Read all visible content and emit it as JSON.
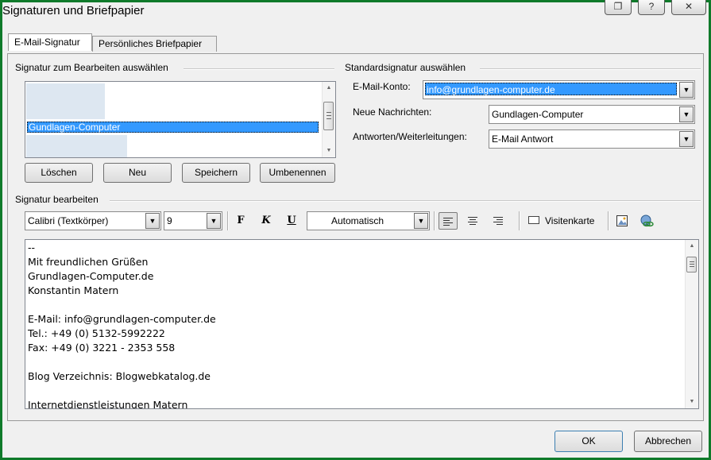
{
  "window": {
    "title": "Signaturen und Briefpapier",
    "title_buttons": [
      "❐",
      "?",
      "✕"
    ]
  },
  "tabs": [
    {
      "label": "E-Mail-Signatur",
      "active": true
    },
    {
      "label": "Persönliches Briefpapier",
      "active": false
    }
  ],
  "signature_select": {
    "group_label": "Signatur zum Bearbeiten auswählen",
    "items": [
      "",
      "Gundlagen-Computer",
      ""
    ],
    "selected_index": 1,
    "buttons": {
      "delete": "Löschen",
      "new": "Neu",
      "save": "Speichern",
      "rename": "Umbenennen"
    }
  },
  "default_signature": {
    "group_label": "Standardsignatur auswählen",
    "account_label": "E-Mail-Konto:",
    "account_value": "info@grundlagen-computer.de",
    "new_messages_label": "Neue Nachrichten:",
    "new_messages_value": "Gundlagen-Computer",
    "replies_label": "Antworten/Weiterleitungen:",
    "replies_value": "E-Mail Antwort"
  },
  "editor": {
    "group_label": "Signatur bearbeiten",
    "font": "Calibri (Textkörper)",
    "size": "9",
    "bold": "F",
    "italic": "K",
    "underline": "U",
    "color": "Automatisch",
    "business_card": "Visitenkarte",
    "lines": [
      "--",
      "Mit freundlichen Grüßen",
      "Grundlagen-Computer.de",
      "Konstantin Matern",
      "",
      "E-Mail: info@grundlagen-computer.de",
      "Tel.: +49 (0) 5132-5992222",
      "Fax: +49 (0) 3221 - 2353 558",
      "",
      "Blog Verzeichnis: Blogwebkatalog.de",
      "",
      "Internetdienstleistungen Matern"
    ]
  },
  "footer": {
    "ok": "OK",
    "cancel": "Abbrechen"
  },
  "colors": {
    "selection": "#3399ff",
    "frame": "#0f7a2a",
    "dialog": "#f0f0f0"
  }
}
